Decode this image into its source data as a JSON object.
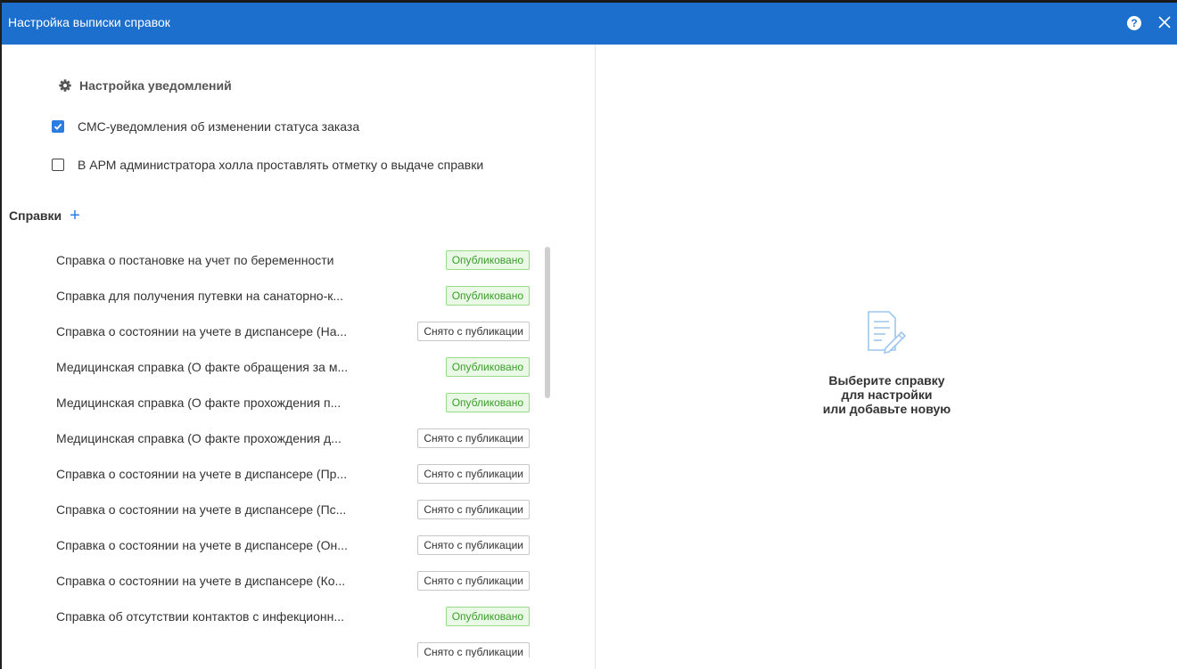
{
  "window": {
    "title": "Настройка выписки справок",
    "help_label": "?"
  },
  "notifications": {
    "heading": "Настройка уведомлений",
    "options": [
      {
        "label": "СМС-уведомления об изменении статуса заказа",
        "checked": true
      },
      {
        "label": "В АРМ администратора холла проставлять отметку о выдаче справки",
        "checked": false
      }
    ]
  },
  "certificates": {
    "heading": "Справки",
    "add_icon": "plus-icon",
    "items": [
      {
        "name": "Справка о постановке на учет по беременности",
        "status": "Опубликовано",
        "published": true
      },
      {
        "name": "Справка для получения путевки на санаторно-к...",
        "status": "Опубликовано",
        "published": true
      },
      {
        "name": "Справка о состоянии на учете в диспансере (На...",
        "status": "Снято с публикации",
        "published": false
      },
      {
        "name": "Медицинская справка (О факте обращения за м...",
        "status": "Опубликовано",
        "published": true
      },
      {
        "name": "Медицинская справка (О факте прохождения п...",
        "status": "Опубликовано",
        "published": true
      },
      {
        "name": "Медицинская справка (О факте прохождения д...",
        "status": "Снято с публикации",
        "published": false
      },
      {
        "name": "Справка о состоянии на учете в диспансере (Пр...",
        "status": "Снято с публикации",
        "published": false
      },
      {
        "name": "Справка о состоянии на учете в диспансере (Пс...",
        "status": "Снято с публикации",
        "published": false
      },
      {
        "name": "Справка о состоянии на учете в диспансере (Он...",
        "status": "Снято с публикации",
        "published": false
      },
      {
        "name": "Справка о состоянии на учете в диспансере (Ко...",
        "status": "Снято с публикации",
        "published": false
      },
      {
        "name": "Справка об отсутствии контактов с инфекционн...",
        "status": "Опубликовано",
        "published": true
      },
      {
        "name": "",
        "status": "Снято с публикации",
        "published": false
      }
    ]
  },
  "empty_state": {
    "icon": "document-edit-icon",
    "lines": [
      "Выберите справку",
      "для настройки",
      "или добавьте новую"
    ]
  },
  "colors": {
    "titlebar": "#1d6fce",
    "accent": "#2b7de0",
    "published_bg": "#eaf9e6",
    "published_text": "#3a9d2a"
  }
}
